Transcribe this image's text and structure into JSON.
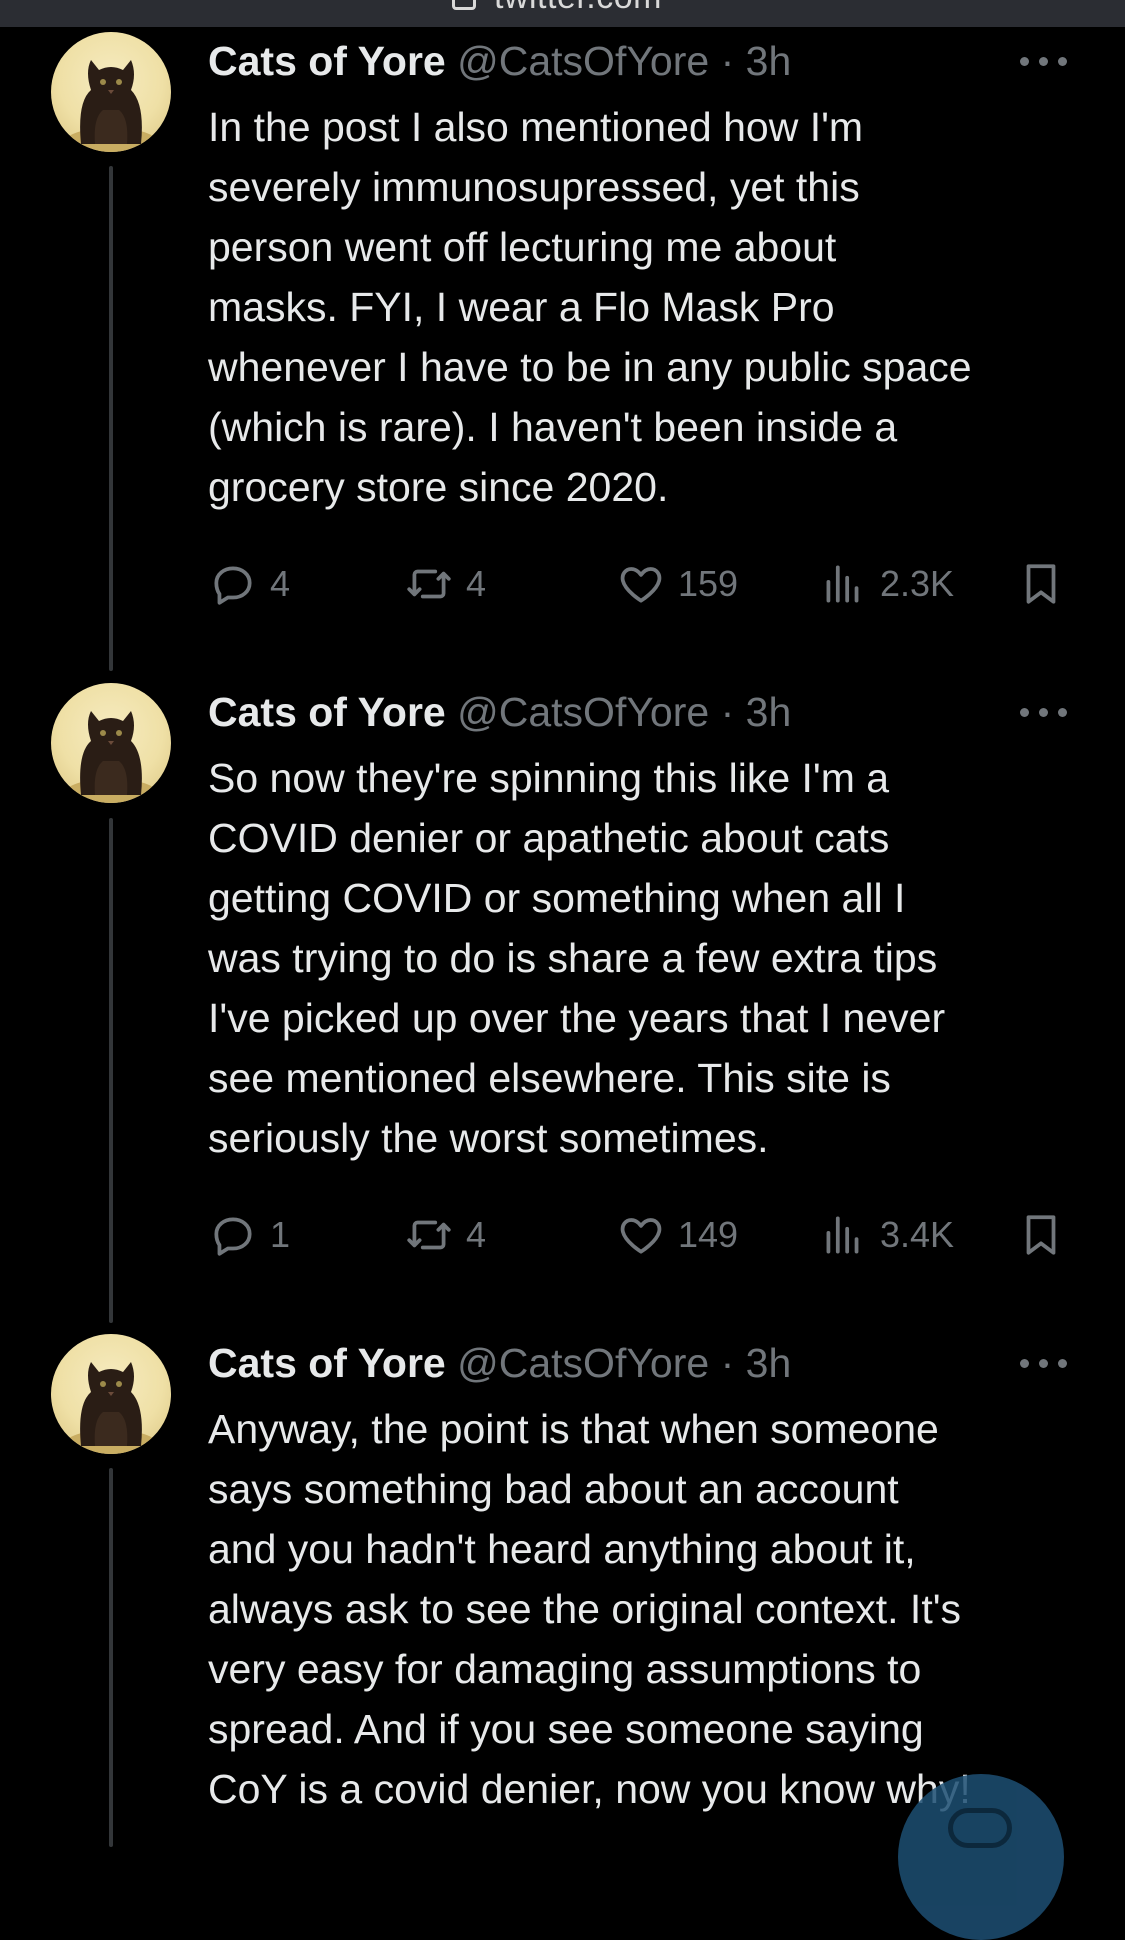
{
  "browser": {
    "url": "twitter.com"
  },
  "tweets": [
    {
      "name": "Cats of Yore",
      "handle": "@CatsOfYore",
      "separator": "·",
      "time": "3h",
      "lines": [
        "In the post I also mentioned how I'm",
        "severely immunosupressed, yet this",
        "person went off lecturing me about",
        "masks. FYI, I wear a Flo Mask Pro",
        "whenever I have to be in any public space",
        "(which is rare). I haven't been inside a",
        "grocery store since 2020."
      ],
      "replies": "4",
      "retweets": "4",
      "likes": "159",
      "views": "2.3K"
    },
    {
      "name": "Cats of Yore",
      "handle": "@CatsOfYore",
      "separator": "·",
      "time": "3h",
      "lines": [
        "So now they're spinning this like I'm a",
        "COVID denier or apathetic about cats",
        "getting COVID or something when all I",
        "was trying to do is share a few extra tips",
        "I've picked up over the years that I never",
        "see mentioned elsewhere. This site is",
        "seriously the worst sometimes."
      ],
      "replies": "1",
      "retweets": "4",
      "likes": "149",
      "views": "3.4K"
    },
    {
      "name": "Cats of Yore",
      "handle": "@CatsOfYore",
      "separator": "·",
      "time": "3h",
      "lines": [
        "Anyway, the point is that when someone",
        "says something bad about an account",
        "and you hadn't heard anything about it,",
        "always ask to see the original context. It's",
        "very easy for damaging assumptions to",
        "spread. And if you see someone saying",
        "CoY is a covid denier, now you know why!"
      ]
    }
  ],
  "icons": {
    "reply": "reply-icon",
    "retweet": "retweet-icon",
    "like": "heart-icon",
    "views": "views-icon",
    "bookmark": "bookmark-icon",
    "more": "more-icon",
    "compose": "compose-icon"
  },
  "colors": {
    "background": "#000000",
    "text": "#e7e9ea",
    "secondary": "#71767b",
    "thread_line": "#333639",
    "fab": "#1d9bf0"
  }
}
